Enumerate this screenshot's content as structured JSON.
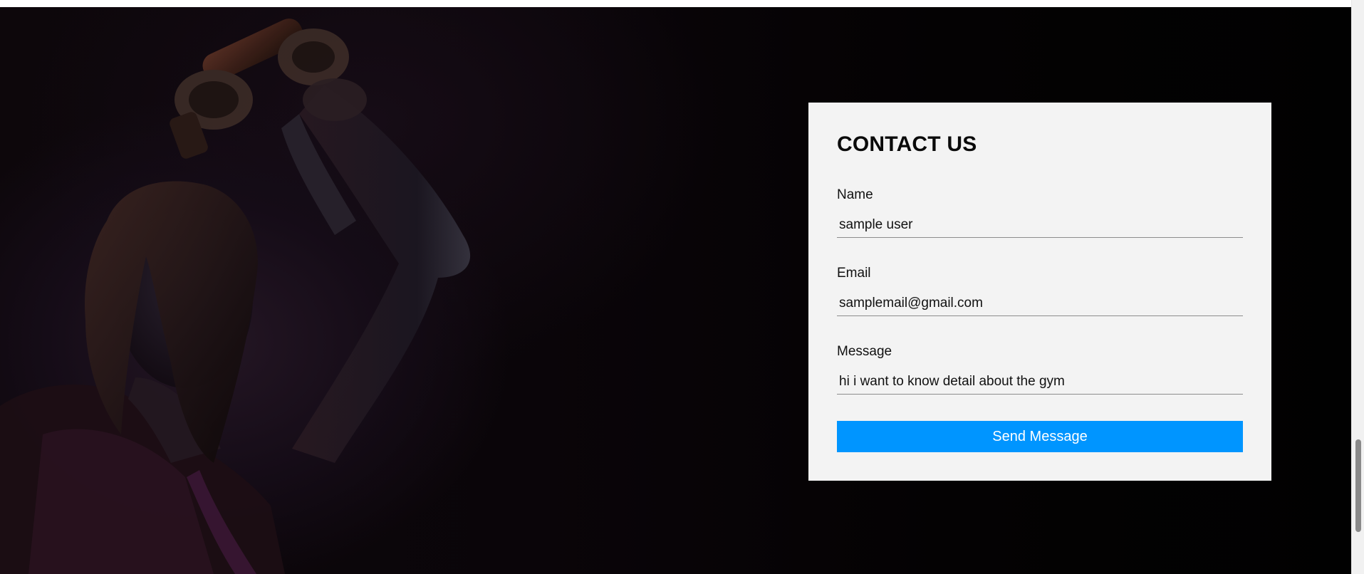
{
  "contact": {
    "title": "CONTACT US",
    "name_label": "Name",
    "name_value": "sample user",
    "email_label": "Email",
    "email_value": "samplemail@gmail.com",
    "message_label": "Message",
    "message_value": "hi i want to know detail about the gym",
    "send_label": "Send Message"
  },
  "colors": {
    "card_background": "#f3f3f3",
    "button_background": "#0095ff",
    "button_text": "#ffffff",
    "hero_background": "#050305"
  },
  "scrollbar": {
    "position": "near-bottom"
  }
}
